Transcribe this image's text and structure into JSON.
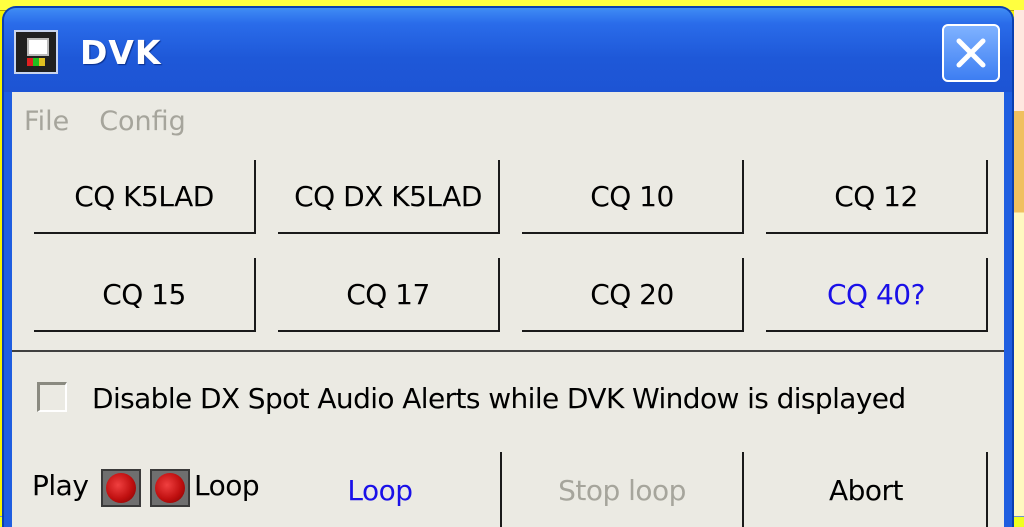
{
  "window": {
    "title": "DVK",
    "close_label": "✕"
  },
  "menu": {
    "items": [
      {
        "label": "File"
      },
      {
        "label": "Config"
      }
    ]
  },
  "buttons": {
    "row1": [
      {
        "label": "CQ K5LAD"
      },
      {
        "label": "CQ DX K5LAD"
      },
      {
        "label": "CQ 10"
      },
      {
        "label": "CQ 12"
      }
    ],
    "row2": [
      {
        "label": "CQ 15"
      },
      {
        "label": "CQ 17"
      },
      {
        "label": "CQ 20"
      },
      {
        "label": "CQ 40?"
      }
    ]
  },
  "options": {
    "disable_alerts_label": "Disable DX Spot Audio Alerts while DVK Window is displayed",
    "disable_alerts_checked": false
  },
  "controls": {
    "play_label": "Play",
    "loop_indicator_label": "Loop",
    "loop_button": "Loop",
    "stop_loop_button": "Stop loop",
    "abort_button": "Abort"
  },
  "colors": {
    "title_bar": "#1e58d8",
    "client_bg": "#ebeae3",
    "link_blue": "#1a10e8",
    "disabled_gray": "#a6a59c",
    "led_red": "#c01010"
  }
}
